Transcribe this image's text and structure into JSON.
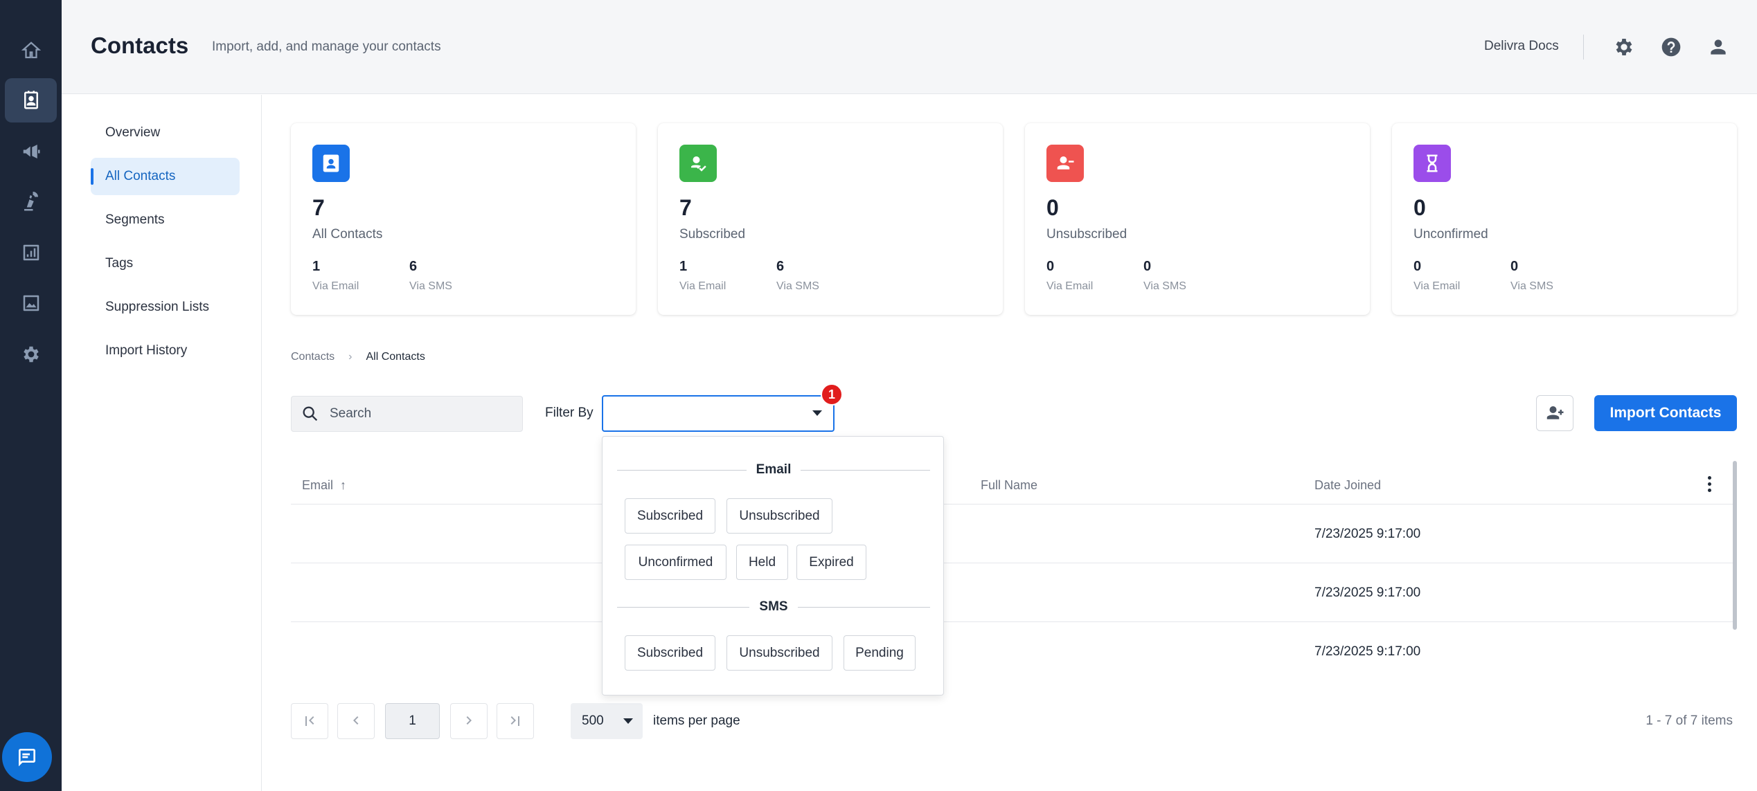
{
  "header": {
    "title": "Contacts",
    "subtitle": "Import, add, and manage your contacts",
    "org_name": "Delivra Docs"
  },
  "rail": {
    "items": [
      "home-icon",
      "contacts-icon",
      "megaphone-icon",
      "automation-icon",
      "reports-icon",
      "media-icon",
      "settings-icon"
    ],
    "active_index": 1,
    "accent": "#1c2638"
  },
  "subnav": {
    "items": [
      "Overview",
      "All Contacts",
      "Segments",
      "Tags",
      "Suppression Lists",
      "Import History"
    ],
    "active": "All Contacts"
  },
  "cards": [
    {
      "value": "7",
      "label": "All Contacts",
      "email_value": "1",
      "email_label": "Via Email",
      "sms_value": "6",
      "sms_label": "Via SMS",
      "color": "#1a73e8",
      "icon": "contact-card-icon"
    },
    {
      "value": "7",
      "label": "Subscribed",
      "email_value": "1",
      "email_label": "Via Email",
      "sms_value": "6",
      "sms_label": "Via SMS",
      "color": "#3bb54a",
      "icon": "user-check-icon"
    },
    {
      "value": "0",
      "label": "Unsubscribed",
      "email_value": "0",
      "email_label": "Via Email",
      "sms_value": "0",
      "sms_label": "Via SMS",
      "color": "#ef5350",
      "icon": "user-minus-icon"
    },
    {
      "value": "0",
      "label": "Unconfirmed",
      "email_value": "0",
      "email_label": "Via Email",
      "sms_value": "0",
      "sms_label": "Via SMS",
      "color": "#9b4dea",
      "icon": "hourglass-icon"
    }
  ],
  "breadcrumb": {
    "root": "Contacts",
    "current": "All Contacts"
  },
  "toolbar": {
    "search_placeholder": "Search",
    "filter_label": "Filter By",
    "filter_value": "",
    "badge_count": "1",
    "import_label": "Import Contacts"
  },
  "table": {
    "columns": [
      "Email",
      "Full Name",
      "Date Joined"
    ],
    "sort_indicator": "↑",
    "rows": [
      {
        "email": "",
        "full_name": "",
        "date_joined": "7/23/2025 9:17:00"
      },
      {
        "email": "",
        "full_name": "",
        "date_joined": "7/23/2025 9:17:00"
      },
      {
        "email": "",
        "full_name": "",
        "date_joined": "7/23/2025 9:17:00"
      }
    ]
  },
  "pagination": {
    "current_page": "1",
    "per_page": "500",
    "per_page_label": "items per page",
    "info": "1 - 7 of 7 items"
  },
  "filter_popup": {
    "groups": [
      {
        "title": "Email",
        "options": [
          "Subscribed",
          "Unsubscribed",
          "Unconfirmed",
          "Held",
          "Expired"
        ]
      },
      {
        "title": "SMS",
        "options": [
          "Subscribed",
          "Unsubscribed",
          "Pending"
        ]
      }
    ]
  }
}
